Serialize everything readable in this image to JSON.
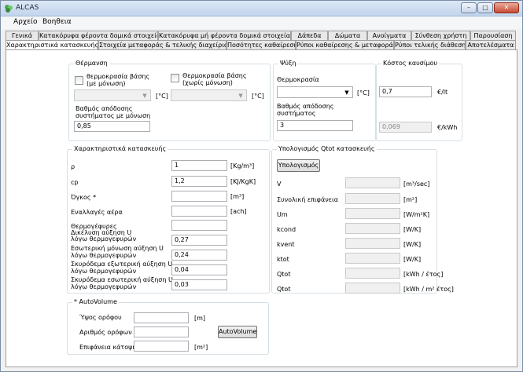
{
  "window": {
    "title": "ALCAS",
    "minimize_glyph": "–",
    "maximize_glyph": "□",
    "close_glyph": "✕"
  },
  "menu": [
    "Αρχείο",
    "Βοηθεια"
  ],
  "tabs_row1": [
    "Γενικά",
    "Κατακόρυφα φέροντα δομικά στοιχεία",
    "Κατακόρυφα μή φέροντα δομικά στοιχεία",
    "Δάπεδα",
    "Δώματα",
    "Ανοίγματα",
    "Σύνθεση χρήστη",
    "Παρουσίαση"
  ],
  "tabs_row2": [
    "Χαρακτηριστικά κατασκευής",
    "Στοιχεία μεταφοράς & τελικής διαχείρισης",
    "Ποσότητες καθαίρεσης",
    "Ρύποι καθαίρεσης & μεταφοράς",
    "Ρύποι τελικής διάθεσης",
    "Αποτελέσματα"
  ],
  "heating": {
    "title": "Θέρμανση",
    "check1_label_l1": "θερμοκρασία βάσης",
    "check1_label_l2": "(με μόνωση)",
    "check2_label_l1": "Θερμοκρασία βάσης",
    "check2_label_l2": "(χωρίς μόνωση)",
    "unit1": "[°C]",
    "unit2": "[°C]",
    "efficiency_label_l1": "Βαθμός απόδοσης",
    "efficiency_label_l2": "συστήματος με μόνωση",
    "efficiency_value": "0,85"
  },
  "cooling": {
    "title": "Ψύξη",
    "temp_label": "Θερμοκρασία",
    "unit": "[°C]",
    "efficiency_label_l1": "Βαθμός απόδοσης",
    "efficiency_label_l2": "συστήματος",
    "efficiency_value": "3"
  },
  "fuel_cost": {
    "title": "Κόστος καυσίμου",
    "value1": "0,7",
    "unit1": "€/lt",
    "value2": "0,069",
    "unit2": "€/kWh"
  },
  "characteristics": {
    "title": "Χαρακτηριστικά κατασκευής",
    "rows": [
      {
        "label_l1": "ρ",
        "label_l2": "",
        "value": "1",
        "unit": "[Kg/m³]"
      },
      {
        "label_l1": "cp",
        "label_l2": "",
        "value": "1,2",
        "unit": "[KJ/KgK]"
      },
      {
        "label_l1": "Όγκος *",
        "label_l2": "",
        "value": "",
        "unit": "[m³]"
      },
      {
        "label_l1": "Εναλλαγές αέρα",
        "label_l2": "",
        "value": "",
        "unit": "[ach]"
      },
      {
        "label_l1": "Θερμογέφυρες",
        "label_l2": "",
        "value": "",
        "unit": ""
      },
      {
        "label_l1": "Δικέλυση αύξηση U",
        "label_l2": "λόγω θερμογεφυρών",
        "value": "0,27",
        "unit": ""
      },
      {
        "label_l1": "Εσωτερική μόνωση αύξηση U",
        "label_l2": "λόγω θερμογεφυρών",
        "value": "0,24",
        "unit": ""
      },
      {
        "label_l1": "Σκυρόδεμα εξωτερική αύξηση U",
        "label_l2": "λόγω θερμογεφυρών",
        "value": "0,04",
        "unit": ""
      },
      {
        "label_l1": "Σκυρόδεμα εσωτερική αύξηση U",
        "label_l2": "λόγω θερμογεφυρών",
        "value": "0,03",
        "unit": ""
      }
    ]
  },
  "qtot": {
    "title": "Υπολογισμός Qtot κατασκευής",
    "button": "Υπολογισμός",
    "rows": [
      {
        "label": "V",
        "unit": "[m³/sec]"
      },
      {
        "label": "Συνολική επιφάνεια",
        "unit": "[m²]"
      },
      {
        "label": "Um",
        "unit": "[W/m²K]"
      },
      {
        "label": "kcond",
        "unit": "[W/K]"
      },
      {
        "label": "kvent",
        "unit": "[W/K]"
      },
      {
        "label": "ktot",
        "unit": "[W/K]"
      },
      {
        "label": "Qtot",
        "unit": "[kWh / έτος]"
      },
      {
        "label": "Qtot",
        "unit": "[kWh / m² έτος]"
      }
    ]
  },
  "autovolume": {
    "title": "* AutoVolume",
    "rows": [
      {
        "label": "Ύψος ορόφου",
        "unit": "[m]"
      },
      {
        "label": "Αριθμός ορόφων",
        "unit": ""
      },
      {
        "label": "Επιφάνεια κάτοψης",
        "unit": "[m²]"
      }
    ],
    "button": "AutoVolume"
  }
}
